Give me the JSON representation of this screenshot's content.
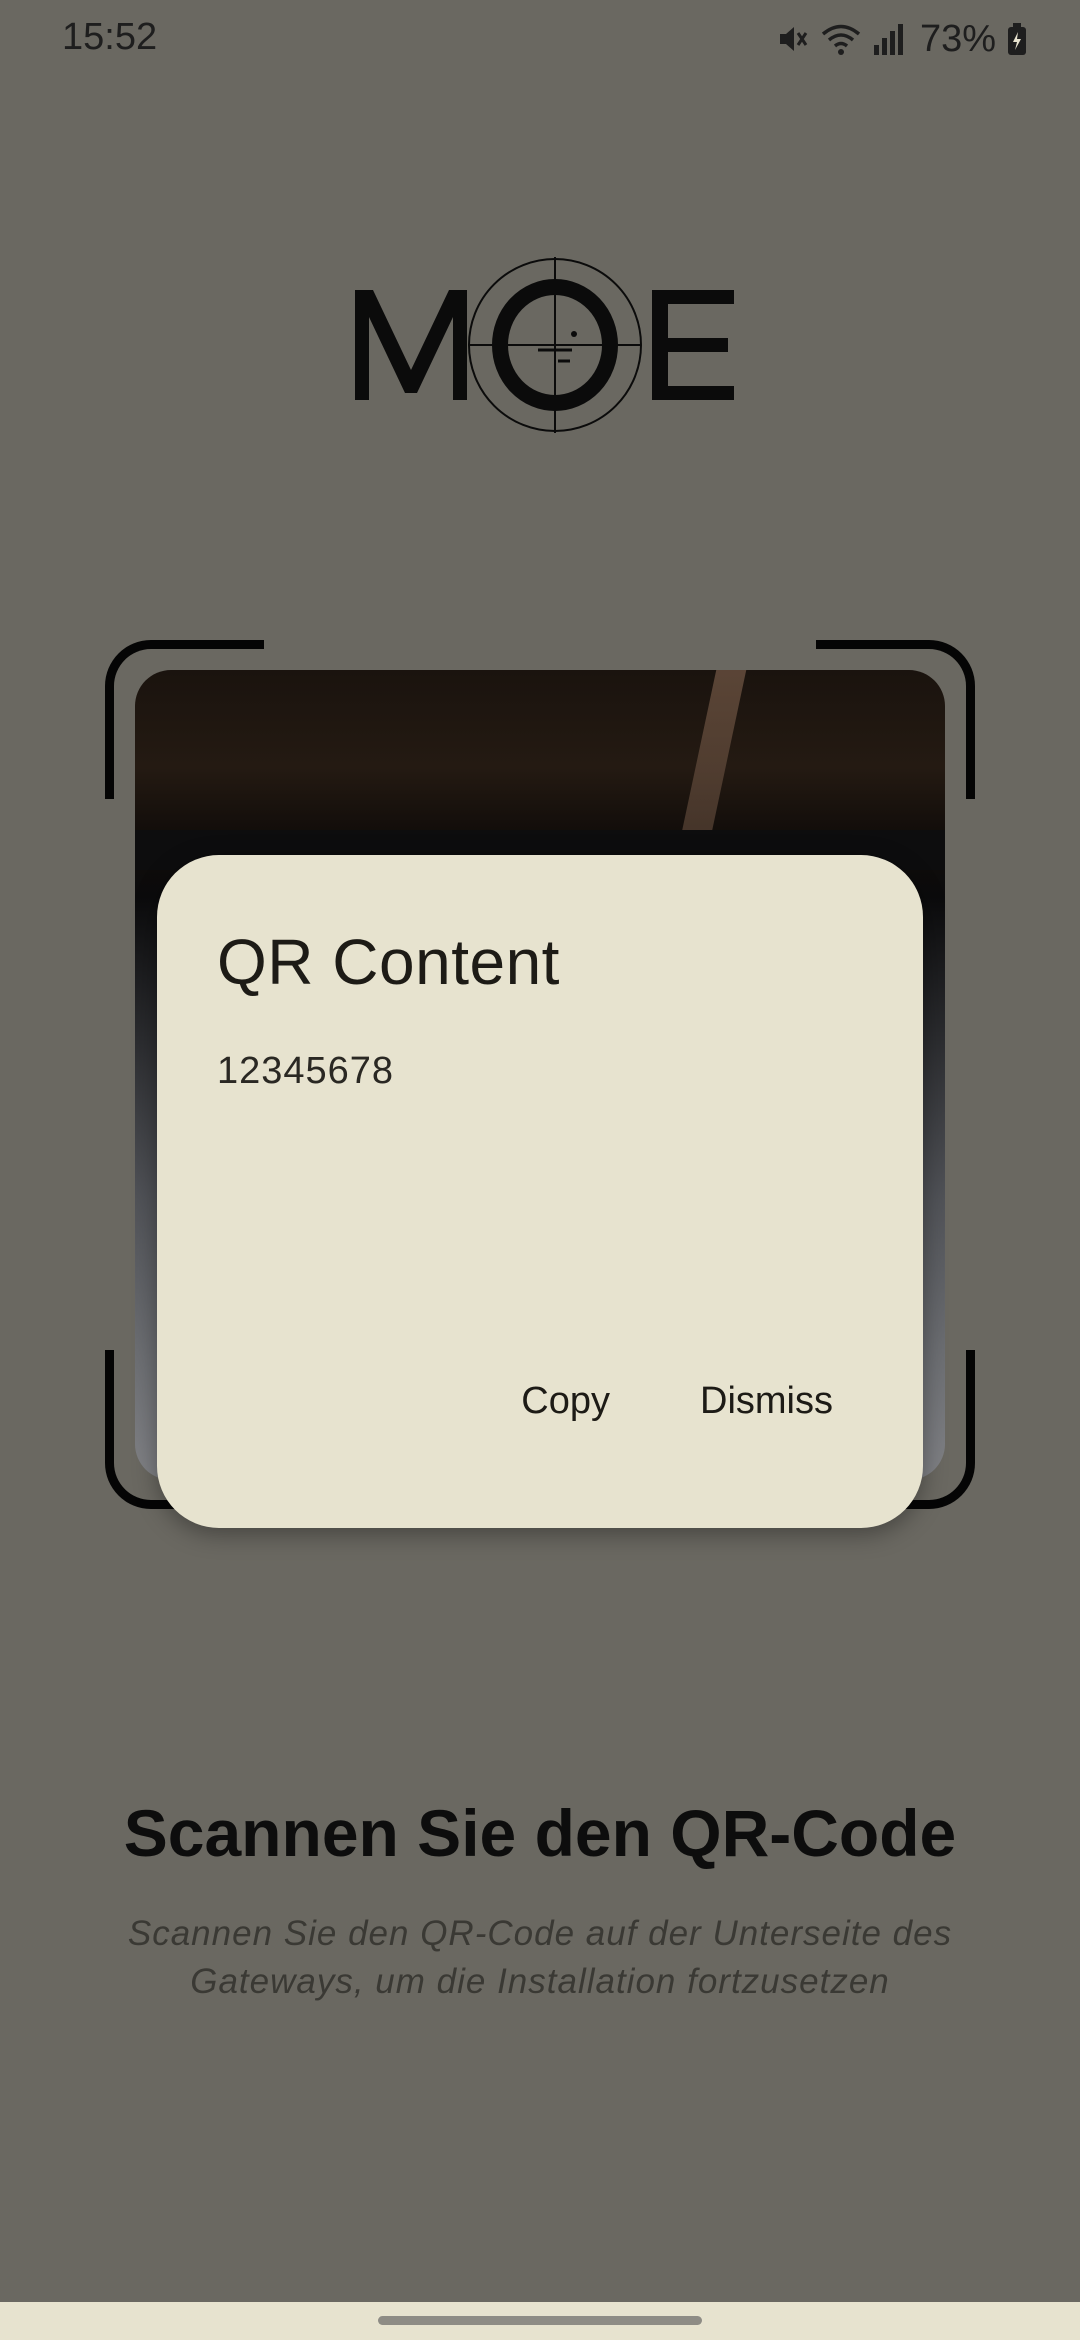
{
  "status_bar": {
    "time": "15:52",
    "battery": "73%",
    "icons": [
      "mute-icon",
      "wifi-icon",
      "signal-icon",
      "battery-icon"
    ]
  },
  "logo": {
    "text": "MOE"
  },
  "dialog": {
    "title": "QR Content",
    "body": "12345678",
    "copy_label": "Copy",
    "dismiss_label": "Dismiss"
  },
  "main": {
    "headline": "Scannen Sie den QR-Code",
    "subtext": "Scannen Sie den QR-Code auf der Unterseite des Gateways, um die Installation fortzusetzen"
  },
  "colors": {
    "background": "#6a6861",
    "dialog_surface": "#e7e3cf",
    "text_dark": "#1d1b16",
    "scanner_corner": "#050505"
  }
}
